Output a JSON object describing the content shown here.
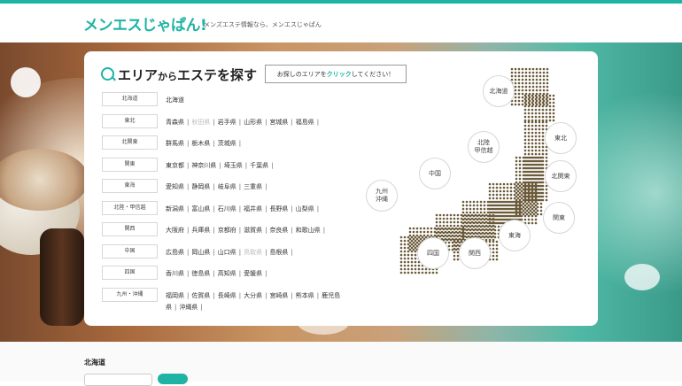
{
  "header": {
    "logo": "メンエスじゃぱん!",
    "tagline": "メンズエステ情報なら、メンエスじゃぱん"
  },
  "panel": {
    "title_a": "エリア",
    "title_b": "から",
    "title_c": "エステを探す",
    "notice_before": "お探しのエリアを",
    "notice_highlight": "クリック",
    "notice_after": "してください！"
  },
  "regions": [
    {
      "label": "北海道",
      "prefs": [
        {
          "name": "北海道"
        }
      ]
    },
    {
      "label": "東北",
      "prefs": [
        {
          "name": "青森県"
        },
        {
          "name": "秋田県",
          "dim": true
        },
        {
          "name": "岩手県"
        },
        {
          "name": "山形県"
        },
        {
          "name": "宮城県"
        },
        {
          "name": "福島県"
        }
      ]
    },
    {
      "label": "北関東",
      "prefs": [
        {
          "name": "群馬県"
        },
        {
          "name": "栃木県"
        },
        {
          "name": "茨城県"
        }
      ]
    },
    {
      "label": "関東",
      "prefs": [
        {
          "name": "東京都"
        },
        {
          "name": "神奈川県"
        },
        {
          "name": "埼玉県"
        },
        {
          "name": "千葉県"
        }
      ]
    },
    {
      "label": "東海",
      "prefs": [
        {
          "name": "愛知県"
        },
        {
          "name": "静岡県"
        },
        {
          "name": "岐阜県"
        },
        {
          "name": "三重県"
        }
      ]
    },
    {
      "label": "北陸・甲信越",
      "prefs": [
        {
          "name": "新潟県"
        },
        {
          "name": "富山県"
        },
        {
          "name": "石川県"
        },
        {
          "name": "福井県"
        },
        {
          "name": "長野県"
        },
        {
          "name": "山梨県"
        }
      ]
    },
    {
      "label": "関西",
      "prefs": [
        {
          "name": "大阪府"
        },
        {
          "name": "兵庫県"
        },
        {
          "name": "京都府"
        },
        {
          "name": "滋賀県"
        },
        {
          "name": "奈良県"
        },
        {
          "name": "和歌山県"
        }
      ]
    },
    {
      "label": "中国",
      "prefs": [
        {
          "name": "広島県"
        },
        {
          "name": "岡山県"
        },
        {
          "name": "山口県"
        },
        {
          "name": "鳥取県",
          "dim": true
        },
        {
          "name": "島根県"
        }
      ]
    },
    {
      "label": "四国",
      "prefs": [
        {
          "name": "香川県"
        },
        {
          "name": "徳島県"
        },
        {
          "name": "高知県"
        },
        {
          "name": "愛媛県"
        }
      ]
    },
    {
      "label": "九州・沖縄",
      "prefs": [
        {
          "name": "福岡県"
        },
        {
          "name": "佐賀県"
        },
        {
          "name": "長崎県"
        },
        {
          "name": "大分県"
        },
        {
          "name": "宮崎県"
        },
        {
          "name": "熊本県"
        },
        {
          "name": "鹿児島県"
        },
        {
          "name": "沖縄県"
        }
      ]
    }
  ],
  "map_labels": [
    {
      "key": "hokkaido",
      "text": "北海道"
    },
    {
      "key": "tohoku",
      "text": "東北"
    },
    {
      "key": "hokuriku",
      "text": "北陸\n甲信越"
    },
    {
      "key": "chugoku",
      "text": "中国"
    },
    {
      "key": "kitakanto",
      "text": "北関東"
    },
    {
      "key": "kyushu",
      "text": "九州\n沖縄"
    },
    {
      "key": "kanto",
      "text": "関東"
    },
    {
      "key": "tokai",
      "text": "東海"
    },
    {
      "key": "shikoku",
      "text": "四国"
    },
    {
      "key": "kansai",
      "text": "関西"
    }
  ],
  "below": {
    "section_title": "北海道"
  },
  "colors": {
    "accent": "#1fb3a3",
    "map_dots": "#6b5a3a"
  }
}
